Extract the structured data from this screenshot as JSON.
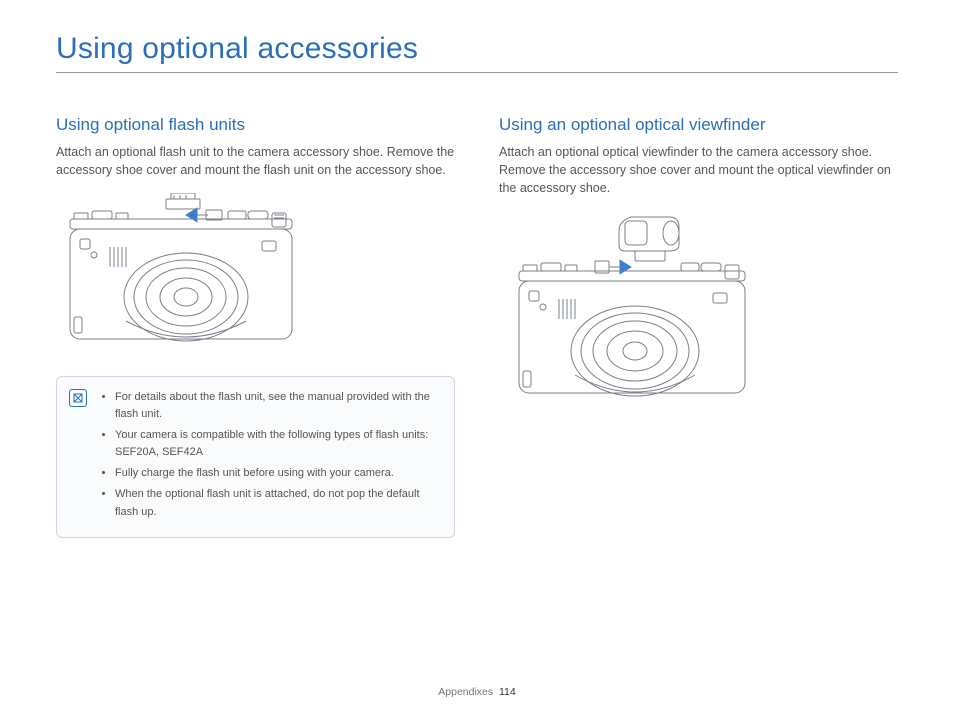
{
  "title": "Using optional accessories",
  "left": {
    "heading": "Using optional flash units",
    "body": "Attach an optional flash unit to the camera accessory shoe. Remove the accessory shoe cover and mount the flash unit on the accessory shoe.",
    "notes": [
      "For details about the flash unit, see the manual provided with the flash unit.",
      "Your camera is compatible with the following types of flash units: SEF20A, SEF42A",
      "Fully charge the flash unit before using with your camera.",
      "When the optional flash unit is attached, do not pop the default flash up."
    ]
  },
  "right": {
    "heading": "Using an optional optical viewfinder",
    "body": "Attach an optional optical viewfinder to the camera accessory shoe. Remove the accessory shoe cover and mount the optical viewfinder on the accessory shoe."
  },
  "footer": {
    "section": "Appendixes",
    "page": "114"
  }
}
